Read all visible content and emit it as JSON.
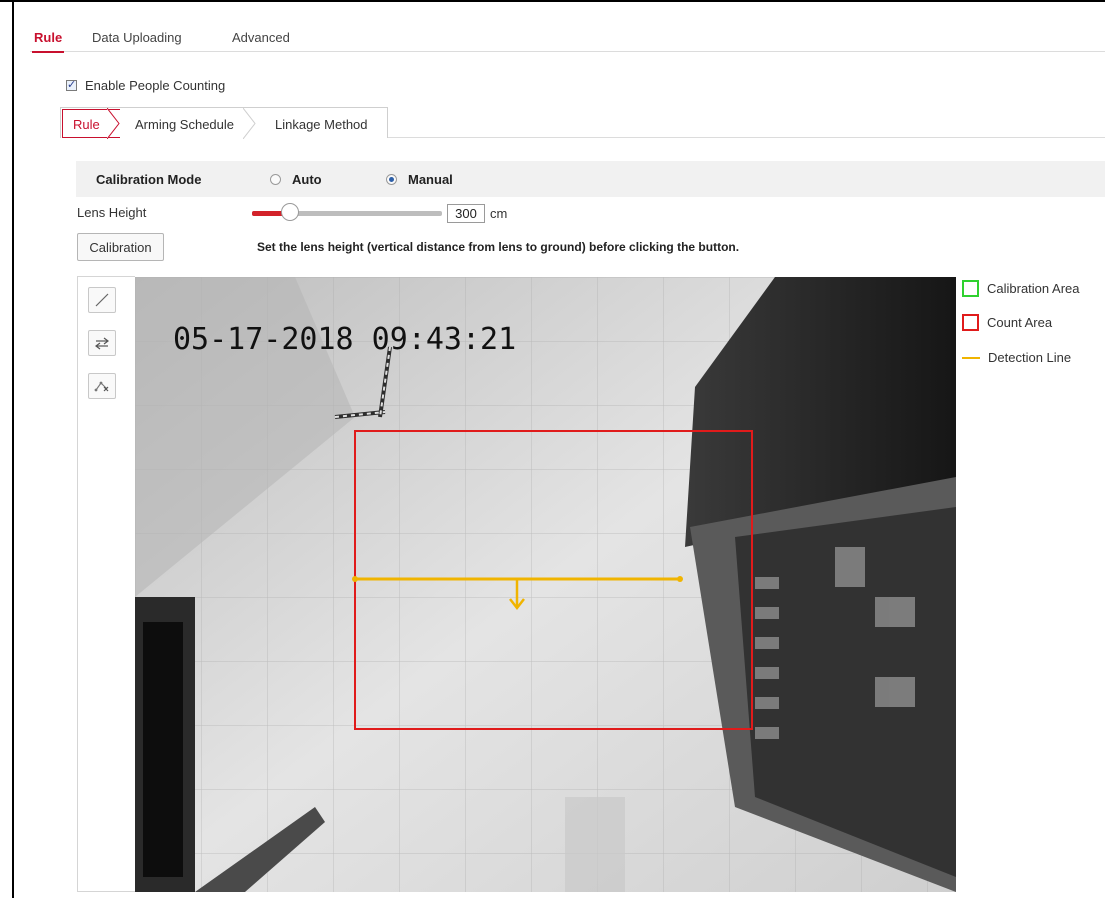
{
  "tabs": {
    "items": [
      "Rule",
      "Data Uploading",
      "Advanced"
    ],
    "active": "Rule"
  },
  "enable": {
    "label": "Enable People Counting",
    "checked": true
  },
  "sub_tabs": {
    "items": [
      "Rule",
      "Arming Schedule",
      "Linkage Method"
    ],
    "active": "Rule"
  },
  "calibration_mode": {
    "label": "Calibration Mode",
    "options": [
      "Auto",
      "Manual"
    ],
    "selected": "Manual"
  },
  "lens_height": {
    "label": "Lens Height",
    "value": "300",
    "unit": "cm",
    "slider_fraction": 0.2
  },
  "calibration_button": {
    "label": "Calibration"
  },
  "calibration_hint": "Set the lens height (vertical distance from lens to ground) before clicking the button.",
  "tools": [
    "line-draw-icon",
    "swap-direction-icon",
    "polygon-draw-icon"
  ],
  "video": {
    "timestamp": "05-17-2018 09:43:21"
  },
  "legend": [
    {
      "label": "Calibration Area",
      "color": "#2fd12f",
      "kind": "box"
    },
    {
      "label": "Count Area",
      "color": "#e01b1b",
      "kind": "box"
    },
    {
      "label": "Detection Line",
      "color": "#f0b400",
      "kind": "line"
    }
  ],
  "colors": {
    "accent": "#c8102e",
    "count_area": "#e01b1b",
    "detection_line": "#f0b400",
    "calibration_area": "#2fd12f"
  }
}
